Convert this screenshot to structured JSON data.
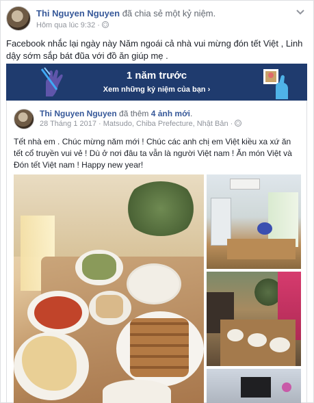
{
  "post": {
    "author": "Thi Nguyen Nguyen",
    "action": "đã chia sẻ một kỷ niệm.",
    "time": "Hôm qua lúc 9:32 ·",
    "caption": "Facebook nhắc lại ngày này Năm ngoái cả nhà vui mừng đón tết Việt , Linh dậy sớm sắp bát đũa với đồ ăn giúp mẹ ."
  },
  "banner": {
    "title": "1 năm trước",
    "subtitle": "Xem những kỷ niệm của bạn ›",
    "bg_color": "#1f3b6e"
  },
  "shared": {
    "author": "Thi Nguyen Nguyen",
    "action_prefix": "đã thêm ",
    "action_bold": "4 ảnh mới",
    "action_suffix": ".",
    "meta": "28 Tháng 1 2017 · Matsudo, Chiba Prefecture, Nhật Bản ·",
    "body": "Tết nhà em . Chúc mừng năm mới ! Chúc các anh chị em Việt kiều xa xứ ăn tết cổ truyền vui vẻ ! Dù ở nơi đâu ta vẫn là người Việt nam ! Ăn món Việt và Đón tết Việt nam ! Happy new year!"
  },
  "photos": [
    {
      "name": "feast-table-photo"
    },
    {
      "name": "kitchen-room-photo"
    },
    {
      "name": "family-table-photo"
    },
    {
      "name": "living-room-photo"
    }
  ],
  "icons": {
    "globe": "globe-icon",
    "chevron": "chevron-down-icon"
  }
}
